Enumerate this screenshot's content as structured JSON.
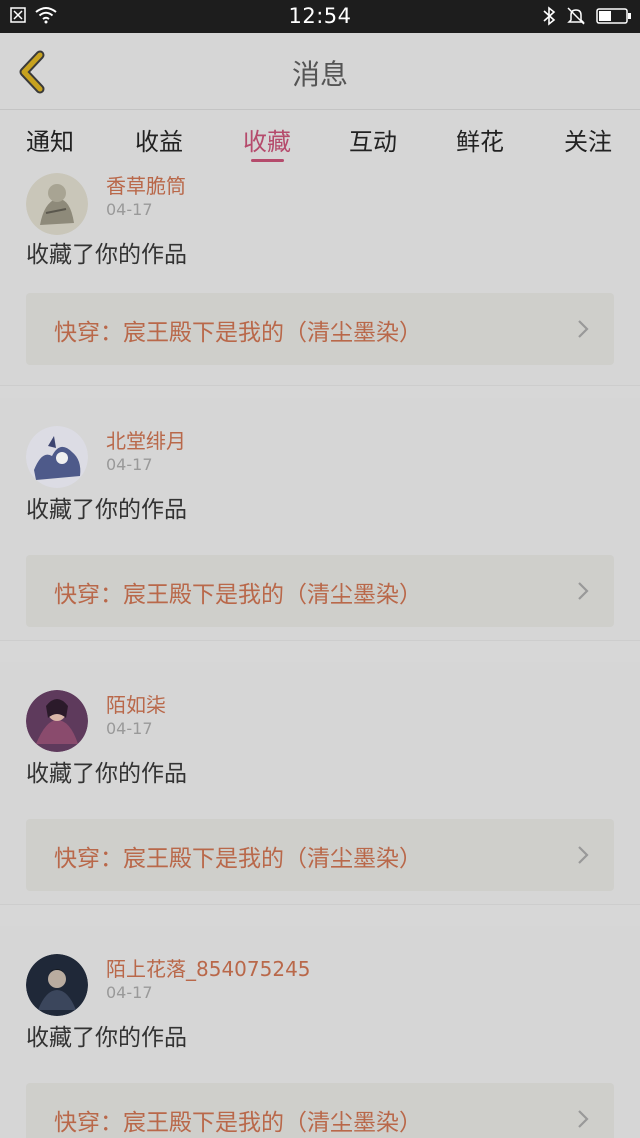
{
  "status_bar": {
    "time": "12:54",
    "left_icons": [
      "notification-x-icon",
      "wifi-icon"
    ],
    "right_icons": [
      "bluetooth-icon",
      "mute-bell-icon",
      "battery-icon"
    ]
  },
  "header": {
    "title": "消息"
  },
  "tabs": [
    {
      "label": "通知",
      "active": false
    },
    {
      "label": "收益",
      "active": false
    },
    {
      "label": "收藏",
      "active": true
    },
    {
      "label": "互动",
      "active": false
    },
    {
      "label": "鲜花",
      "active": false
    },
    {
      "label": "关注",
      "active": false
    }
  ],
  "notifications": [
    {
      "user": "香草脆筒",
      "date": "04-17",
      "action": "收藏了你的作品",
      "work": "快穿：宸王殿下是我的（清尘墨染）"
    },
    {
      "user": "北堂绯月",
      "date": "04-17",
      "action": "收藏了你的作品",
      "work": "快穿：宸王殿下是我的（清尘墨染）"
    },
    {
      "user": "陌如柒",
      "date": "04-17",
      "action": "收藏了你的作品",
      "work": "快穿：宸王殿下是我的（清尘墨染）"
    },
    {
      "user": "陌上花落_854075245",
      "date": "04-17",
      "action": "收藏了你的作品",
      "work": "快穿：宸王殿下是我的（清尘墨染）"
    }
  ],
  "colors": {
    "accent": "#b54b6c",
    "link": "#b9684a",
    "back_arrow": "#c7a21f"
  }
}
